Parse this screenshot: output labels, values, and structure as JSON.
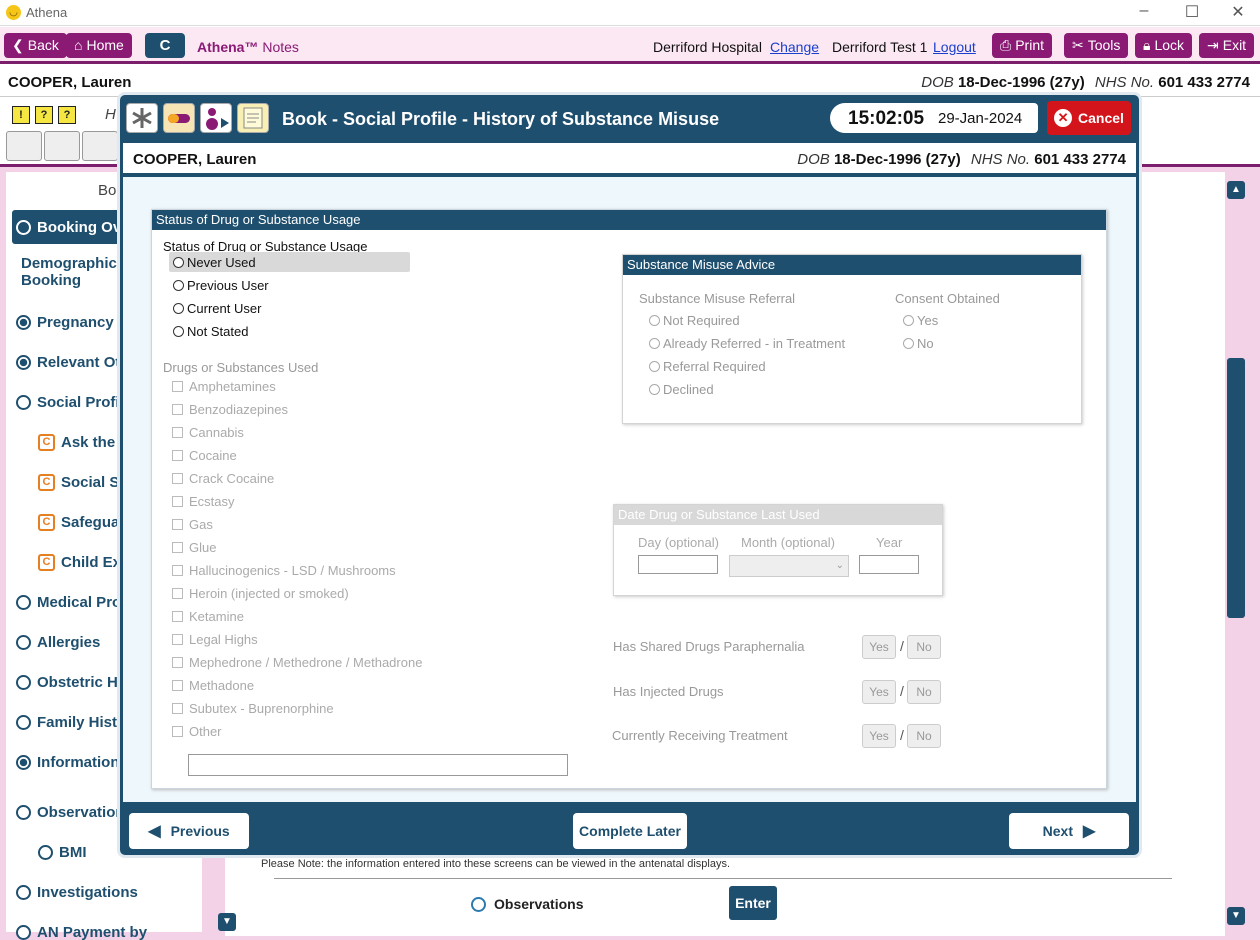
{
  "app": {
    "title": "Athena"
  },
  "nav": {
    "back": "Back",
    "home": "Home",
    "c": "C",
    "notes_brand": "Athena™",
    "notes_suffix": " Notes",
    "hospital": "Derriford Hospital",
    "change": "Change",
    "user": "Derriford Test 1",
    "logout": "Logout",
    "print": "Print",
    "tools": "Tools",
    "lock": "Lock",
    "exit": "Exit"
  },
  "patient": {
    "name": "COOPER, Lauren",
    "dob_label": "DOB",
    "dob": "18-Dec-1996 (27y)",
    "nhs_label": "NHS No.",
    "nhs": "601 433 2774"
  },
  "bg": {
    "toolbar_letter": "H",
    "section_abbrev": "Bo"
  },
  "sidebar": {
    "items": [
      {
        "label": "Booking Ov",
        "state": "empty",
        "active": true
      },
      {
        "label": "Demographics",
        "label2": "Booking",
        "state": "none"
      },
      {
        "label": "Pregnancy I",
        "state": "filled"
      },
      {
        "label": "Relevant Ot",
        "state": "filled"
      },
      {
        "label": "Social Profil",
        "state": "empty"
      },
      {
        "label": "Ask the",
        "state": "c"
      },
      {
        "label": "Social Se",
        "state": "c"
      },
      {
        "label": "Safegua",
        "state": "c"
      },
      {
        "label": "Child Ex",
        "state": "c"
      },
      {
        "label": "Medical Pro",
        "state": "empty"
      },
      {
        "label": "Allergies",
        "state": "empty"
      },
      {
        "label": "Obstetric H",
        "state": "empty"
      },
      {
        "label": "Family Histo",
        "state": "empty"
      },
      {
        "label": "Information",
        "state": "filled"
      },
      {
        "label": "Observation",
        "state": "empty"
      },
      {
        "label": "BMI",
        "state": "empty"
      },
      {
        "label": "Investigations",
        "state": "empty"
      },
      {
        "label": "AN Payment by",
        "state": "empty"
      }
    ]
  },
  "bg_content": {
    "note": "Please Note: the information entered into these screens can be viewed in the antenatal displays.",
    "observations": "Observations",
    "enter": "Enter"
  },
  "modal": {
    "title": "Book - Social Profile - History of Substance Misuse",
    "time": "15:02:05",
    "date": "29-Jan-2024",
    "cancel": "Cancel",
    "status_panel_title": "Status of Drug or Substance Usage",
    "status_label": "Status of Drug or Substance Usage",
    "status_options": [
      "Never Used",
      "Previous User",
      "Current User",
      "Not Stated"
    ],
    "drugs_label": "Drugs or Substances Used",
    "drugs": [
      "Amphetamines",
      "Benzodiazepines",
      "Cannabis",
      "Cocaine",
      "Crack Cocaine",
      "Ecstasy",
      "Gas",
      "Glue",
      "Hallucinogenics - LSD / Mushrooms",
      "Heroin (injected or smoked)",
      "Ketamine",
      "Legal Highs",
      "Mephedrone / Methedrone / Methadrone",
      "Methadone",
      "Subutex - Buprenorphine",
      "Other"
    ],
    "advice": {
      "title": "Substance Misuse Advice",
      "referral_label": "Substance Misuse Referral",
      "referral_options": [
        "Not Required",
        "Already Referred - in Treatment",
        "Referral Required",
        "Declined"
      ],
      "consent_label": "Consent Obtained",
      "consent_options": [
        "Yes",
        "No"
      ]
    },
    "last_used": {
      "title": "Date Drug or Substance Last Used",
      "day": "Day (optional)",
      "month": "Month (optional)",
      "year": "Year"
    },
    "questions": [
      {
        "label": "Has Shared Drugs Paraphernalia",
        "yes": "Yes",
        "no": "No"
      },
      {
        "label": "Has Injected Drugs",
        "yes": "Yes",
        "no": "No"
      },
      {
        "label": "Currently Receiving Treatment",
        "yes": "Yes",
        "no": "No"
      }
    ],
    "footer": {
      "previous": "Previous",
      "complete_later": "Complete Later",
      "next": "Next"
    }
  },
  "colors": {
    "brand": "#8a1a74",
    "primary": "#1f4f6e",
    "cancel": "#d4141b"
  }
}
